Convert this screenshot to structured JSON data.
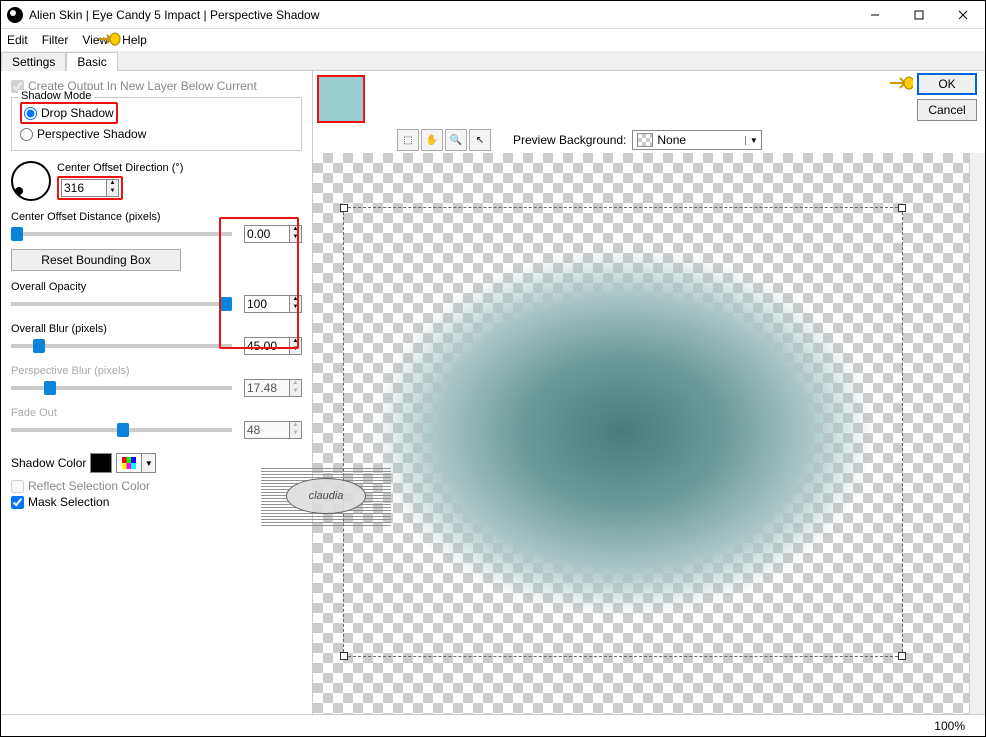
{
  "window": {
    "title": "Alien Skin | Eye Candy 5 Impact | Perspective Shadow"
  },
  "menu": {
    "edit": "Edit",
    "filter": "Filter",
    "view": "View",
    "help": "Help"
  },
  "tabs": {
    "settings": "Settings",
    "basic": "Basic"
  },
  "panel": {
    "create_output": "Create Output In New Layer Below Current",
    "shadow_mode_legend": "Shadow Mode",
    "drop_shadow": "Drop Shadow",
    "perspective_shadow": "Perspective Shadow",
    "center_offset_dir_label": "Center Offset Direction (°)",
    "center_offset_dir_value": "316",
    "center_offset_dist_label": "Center Offset Distance (pixels)",
    "center_offset_dist_value": "0.00",
    "reset_bbox": "Reset Bounding Box",
    "overall_opacity_label": "Overall Opacity",
    "overall_opacity_value": "100",
    "overall_blur_label": "Overall Blur (pixels)",
    "overall_blur_value": "45.00",
    "perspective_blur_label": "Perspective Blur (pixels)",
    "perspective_blur_value": "17.48",
    "fade_out_label": "Fade Out",
    "fade_out_value": "48",
    "shadow_color_label": "Shadow Color",
    "reflect_selection": "Reflect Selection Color",
    "mask_selection": "Mask Selection"
  },
  "right": {
    "preview_bg_label": "Preview Background:",
    "preview_bg_value": "None",
    "ok": "OK",
    "cancel": "Cancel"
  },
  "watermark": "claudia",
  "status": {
    "zoom": "100%"
  }
}
